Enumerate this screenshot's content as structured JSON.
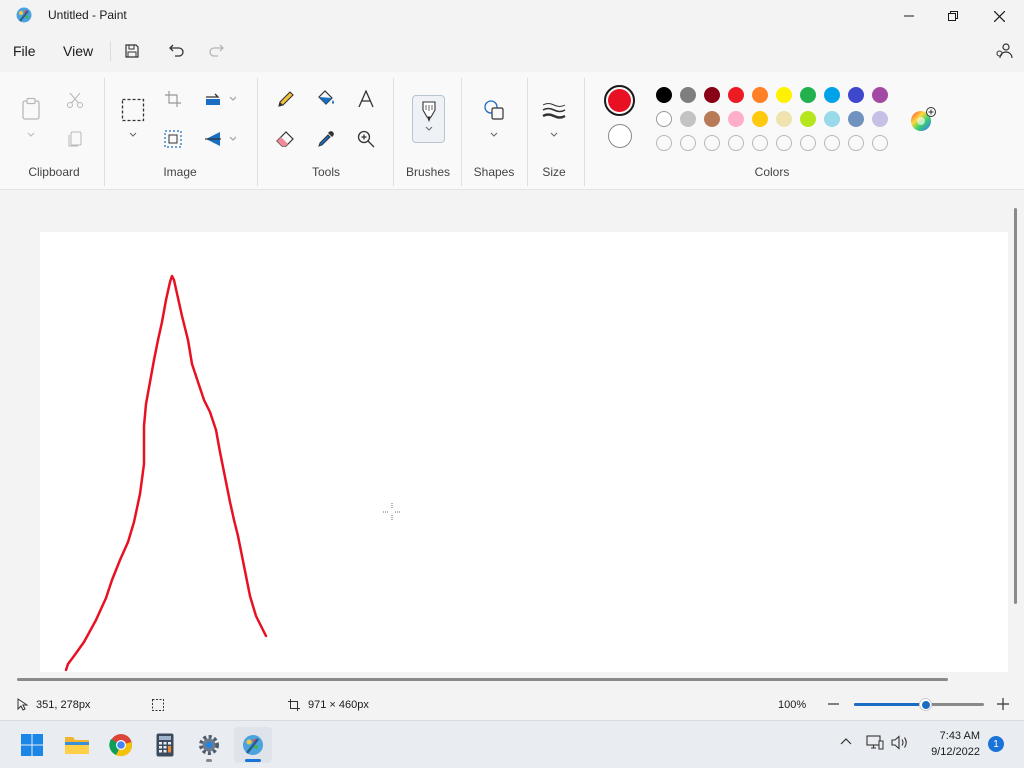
{
  "window": {
    "title": "Untitled - Paint"
  },
  "menu": {
    "file": "File",
    "view": "View"
  },
  "ribbon": {
    "groups": {
      "clipboard": "Clipboard",
      "image": "Image",
      "tools": "Tools",
      "brushes": "Brushes",
      "shapes": "Shapes",
      "size": "Size",
      "colors": "Colors"
    },
    "primary_color": "#e81123",
    "secondary_color": "#ffffff",
    "palette_row1": [
      "#000000",
      "#7f7f7f",
      "#880015",
      "#ed1c24",
      "#ff7f27",
      "#fff200",
      "#22b14c",
      "#00a2e8",
      "#3f48cc",
      "#a349a4"
    ],
    "palette_row2": [
      "#ffffff",
      "#c3c3c3",
      "#b97a57",
      "#ffaec9",
      "#ffc90e",
      "#efe4b0",
      "#b5e61d",
      "#99d9ea",
      "#7092be",
      "#c8bfe7"
    ],
    "palette_row3_count": 10
  },
  "status": {
    "cursor_position": "351, 278px",
    "canvas_size": "971 × 460px",
    "zoom": "100%",
    "zoom_level": 0.55
  },
  "taskbar": {
    "apps": [
      "start-icon",
      "file-explorer-icon",
      "chrome-icon",
      "calculator-icon",
      "settings-icon",
      "paint-icon"
    ],
    "time": "7:43 AM",
    "date": "9/12/2022",
    "notifications": "1"
  }
}
